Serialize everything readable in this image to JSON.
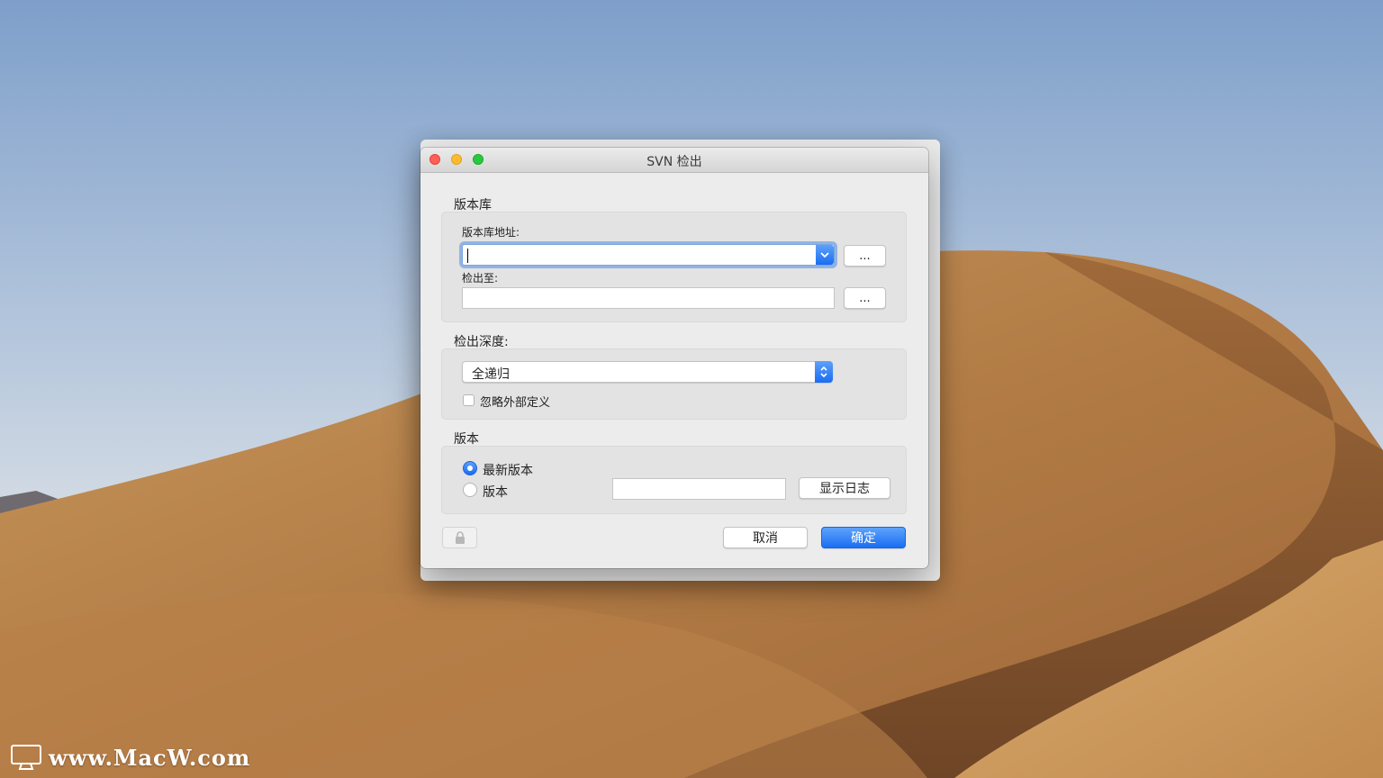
{
  "window": {
    "title": "SVN 检出"
  },
  "repository": {
    "section_label": "版本库",
    "url_label": "版本库地址:",
    "url_value": "",
    "url_browse_label": "...",
    "checkout_to_label": "检出至:",
    "checkout_to_value": "",
    "checkout_browse_label": "..."
  },
  "depth": {
    "section_label": "检出深度:",
    "selected": "全递归",
    "ignore_externals_label": "忽略外部定义",
    "ignore_externals_checked": false
  },
  "revision": {
    "section_label": "版本",
    "options": [
      "最新版本",
      "版本"
    ],
    "selected_option": "最新版本",
    "revision_value": "",
    "show_log_label": "显示日志"
  },
  "footer": {
    "cancel_label": "取消",
    "ok_label": "确定"
  },
  "watermark": {
    "text": "www.MacW.com"
  },
  "colors": {
    "accent": "#1b6ef3",
    "focus_ring": "#7aa6df",
    "window_bg": "#ececec",
    "group_bg": "#e3e3e3"
  }
}
